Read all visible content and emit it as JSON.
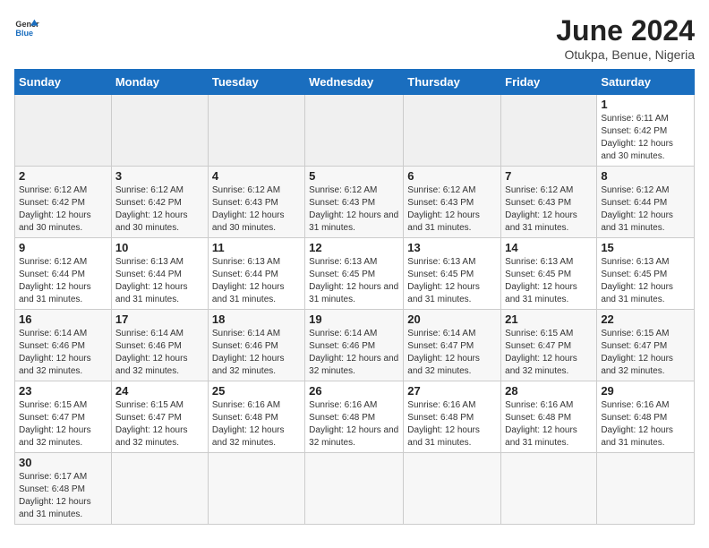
{
  "logo": {
    "line1": "General",
    "line2": "Blue"
  },
  "title": "June 2024",
  "subtitle": "Otukpa, Benue, Nigeria",
  "headers": [
    "Sunday",
    "Monday",
    "Tuesday",
    "Wednesday",
    "Thursday",
    "Friday",
    "Saturday"
  ],
  "weeks": [
    [
      {
        "day": "",
        "info": ""
      },
      {
        "day": "",
        "info": ""
      },
      {
        "day": "",
        "info": ""
      },
      {
        "day": "",
        "info": ""
      },
      {
        "day": "",
        "info": ""
      },
      {
        "day": "",
        "info": ""
      },
      {
        "day": "1",
        "info": "Sunrise: 6:11 AM\nSunset: 6:42 PM\nDaylight: 12 hours and 30 minutes."
      }
    ],
    [
      {
        "day": "2",
        "info": "Sunrise: 6:12 AM\nSunset: 6:42 PM\nDaylight: 12 hours and 30 minutes."
      },
      {
        "day": "3",
        "info": "Sunrise: 6:12 AM\nSunset: 6:42 PM\nDaylight: 12 hours and 30 minutes."
      },
      {
        "day": "4",
        "info": "Sunrise: 6:12 AM\nSunset: 6:43 PM\nDaylight: 12 hours and 30 minutes."
      },
      {
        "day": "5",
        "info": "Sunrise: 6:12 AM\nSunset: 6:43 PM\nDaylight: 12 hours and 31 minutes."
      },
      {
        "day": "6",
        "info": "Sunrise: 6:12 AM\nSunset: 6:43 PM\nDaylight: 12 hours and 31 minutes."
      },
      {
        "day": "7",
        "info": "Sunrise: 6:12 AM\nSunset: 6:43 PM\nDaylight: 12 hours and 31 minutes."
      },
      {
        "day": "8",
        "info": "Sunrise: 6:12 AM\nSunset: 6:44 PM\nDaylight: 12 hours and 31 minutes."
      }
    ],
    [
      {
        "day": "9",
        "info": "Sunrise: 6:12 AM\nSunset: 6:44 PM\nDaylight: 12 hours and 31 minutes."
      },
      {
        "day": "10",
        "info": "Sunrise: 6:13 AM\nSunset: 6:44 PM\nDaylight: 12 hours and 31 minutes."
      },
      {
        "day": "11",
        "info": "Sunrise: 6:13 AM\nSunset: 6:44 PM\nDaylight: 12 hours and 31 minutes."
      },
      {
        "day": "12",
        "info": "Sunrise: 6:13 AM\nSunset: 6:45 PM\nDaylight: 12 hours and 31 minutes."
      },
      {
        "day": "13",
        "info": "Sunrise: 6:13 AM\nSunset: 6:45 PM\nDaylight: 12 hours and 31 minutes."
      },
      {
        "day": "14",
        "info": "Sunrise: 6:13 AM\nSunset: 6:45 PM\nDaylight: 12 hours and 31 minutes."
      },
      {
        "day": "15",
        "info": "Sunrise: 6:13 AM\nSunset: 6:45 PM\nDaylight: 12 hours and 31 minutes."
      }
    ],
    [
      {
        "day": "16",
        "info": "Sunrise: 6:14 AM\nSunset: 6:46 PM\nDaylight: 12 hours and 32 minutes."
      },
      {
        "day": "17",
        "info": "Sunrise: 6:14 AM\nSunset: 6:46 PM\nDaylight: 12 hours and 32 minutes."
      },
      {
        "day": "18",
        "info": "Sunrise: 6:14 AM\nSunset: 6:46 PM\nDaylight: 12 hours and 32 minutes."
      },
      {
        "day": "19",
        "info": "Sunrise: 6:14 AM\nSunset: 6:46 PM\nDaylight: 12 hours and 32 minutes."
      },
      {
        "day": "20",
        "info": "Sunrise: 6:14 AM\nSunset: 6:47 PM\nDaylight: 12 hours and 32 minutes."
      },
      {
        "day": "21",
        "info": "Sunrise: 6:15 AM\nSunset: 6:47 PM\nDaylight: 12 hours and 32 minutes."
      },
      {
        "day": "22",
        "info": "Sunrise: 6:15 AM\nSunset: 6:47 PM\nDaylight: 12 hours and 32 minutes."
      }
    ],
    [
      {
        "day": "23",
        "info": "Sunrise: 6:15 AM\nSunset: 6:47 PM\nDaylight: 12 hours and 32 minutes."
      },
      {
        "day": "24",
        "info": "Sunrise: 6:15 AM\nSunset: 6:47 PM\nDaylight: 12 hours and 32 minutes."
      },
      {
        "day": "25",
        "info": "Sunrise: 6:16 AM\nSunset: 6:48 PM\nDaylight: 12 hours and 32 minutes."
      },
      {
        "day": "26",
        "info": "Sunrise: 6:16 AM\nSunset: 6:48 PM\nDaylight: 12 hours and 32 minutes."
      },
      {
        "day": "27",
        "info": "Sunrise: 6:16 AM\nSunset: 6:48 PM\nDaylight: 12 hours and 31 minutes."
      },
      {
        "day": "28",
        "info": "Sunrise: 6:16 AM\nSunset: 6:48 PM\nDaylight: 12 hours and 31 minutes."
      },
      {
        "day": "29",
        "info": "Sunrise: 6:16 AM\nSunset: 6:48 PM\nDaylight: 12 hours and 31 minutes."
      }
    ],
    [
      {
        "day": "30",
        "info": "Sunrise: 6:17 AM\nSunset: 6:48 PM\nDaylight: 12 hours and 31 minutes."
      },
      {
        "day": "",
        "info": ""
      },
      {
        "day": "",
        "info": ""
      },
      {
        "day": "",
        "info": ""
      },
      {
        "day": "",
        "info": ""
      },
      {
        "day": "",
        "info": ""
      },
      {
        "day": "",
        "info": ""
      }
    ]
  ]
}
